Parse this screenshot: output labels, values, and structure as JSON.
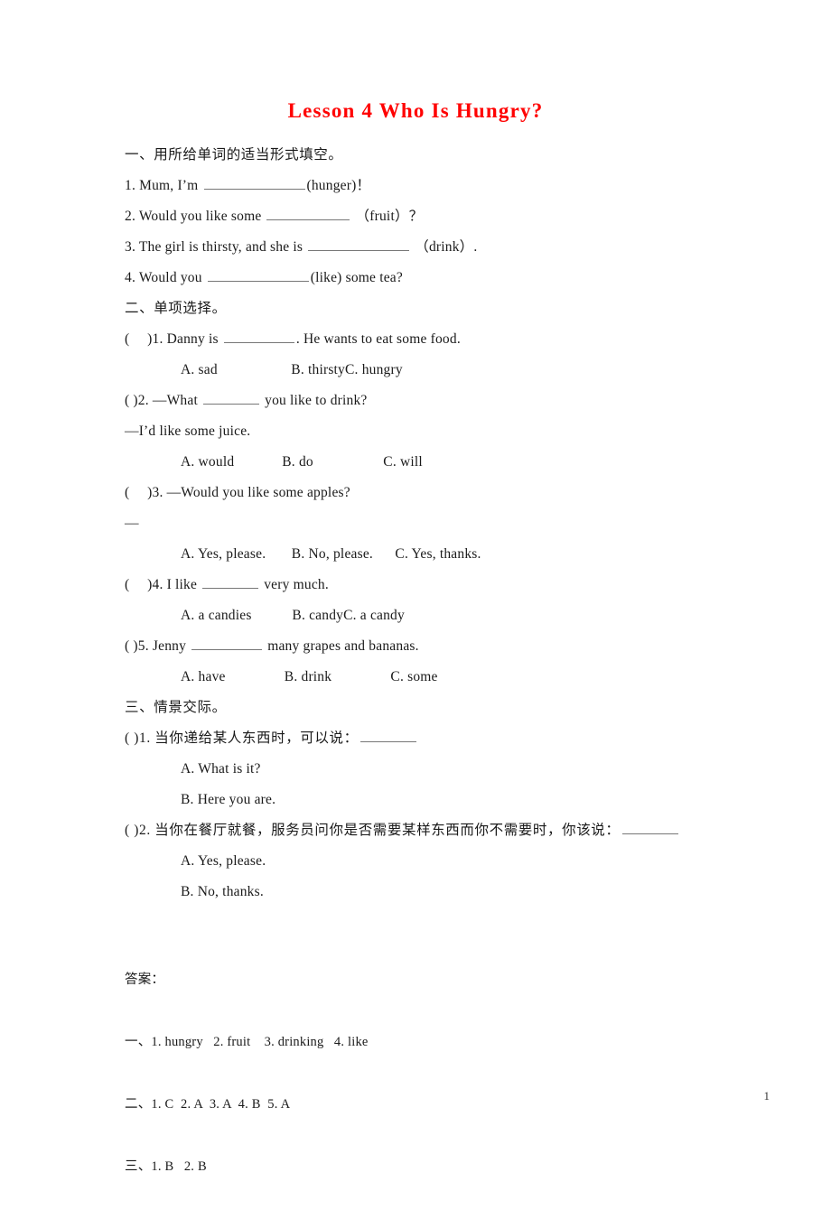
{
  "document": {
    "title": "Lesson 4 Who Is Hungry?",
    "title_color": "#ff0000",
    "page_number": "1"
  },
  "sections": [
    {
      "heading": "一、用所给单词的适当形式填空。",
      "items": [
        {
          "pre": "1. Mum, I’m ",
          "post": "(hunger)！",
          "blank": "b-xl"
        },
        {
          "pre": "2. Would you like some ",
          "post": " （fruit）？",
          "blank": "b-lg"
        },
        {
          "pre": "3. The girl is thirsty, and she is ",
          "post": " （drink）.",
          "blank": "b-xl"
        },
        {
          "pre": "4. Would you ",
          "post": "(like) some tea?",
          "blank": "b-xl"
        }
      ]
    },
    {
      "heading": "二、单项选择。",
      "questions": [
        {
          "stem_pre": "(　 )1. Danny is ",
          "stem_post": ". He wants to eat some food.",
          "blank": "b-md",
          "options": "A. sad                    B. thirstyC. hungry"
        },
        {
          "stem_pre": "( )2. —What ",
          "stem_post": " you like to drink?",
          "blank": "b-sm",
          "continuation": "—I’d like some juice.",
          "options": "A. would             B. do                   C. will"
        },
        {
          "stem_pre": "(　 )3. —Would you like some apples?",
          "stem_post": "",
          "blank": "",
          "continuation": "—",
          "options": "A. Yes, please.       B. No, please.      C. Yes, thanks."
        },
        {
          "stem_pre": "(　 )4. I like ",
          "stem_post": " very much.",
          "blank": "b-sm",
          "options": "A. a candies           B. candyC. a candy"
        },
        {
          "stem_pre": "( )5. Jenny ",
          "stem_post": " many grapes and bananas.",
          "blank": "b-md",
          "options": "A. have                B. drink                C. some"
        }
      ]
    },
    {
      "heading": "三、情景交际。",
      "questions": [
        {
          "stem_pre": "( )1. 当你递给某人东西时，可以说：",
          "stem_post": "",
          "blank": "b-sm",
          "options": [
            "A. What is it?",
            "B. Here you are."
          ]
        },
        {
          "stem_pre": "( )2. 当你在餐厅就餐，服务员问你是否需要某样东西而你不需要时，你该说：",
          "stem_post": "",
          "blank": "b-sm",
          "options": [
            "A. Yes, please.",
            "B. No, thanks."
          ]
        }
      ]
    }
  ],
  "answer_key": {
    "label": "答案：",
    "lines": [
      "一、1. hungry   2. fruit    3. drinking   4. like",
      "二、1. C  2. A  3. A  4. B  5. A",
      "三、1. B   2. B"
    ]
  }
}
